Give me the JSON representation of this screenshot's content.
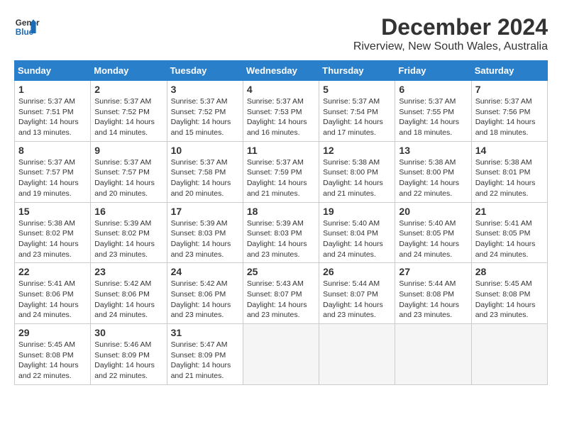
{
  "logo": {
    "general": "General",
    "blue": "Blue"
  },
  "title": "December 2024",
  "location": "Riverview, New South Wales, Australia",
  "weekdays": [
    "Sunday",
    "Monday",
    "Tuesday",
    "Wednesday",
    "Thursday",
    "Friday",
    "Saturday"
  ],
  "weeks": [
    [
      {
        "day": 1,
        "sunrise": "5:37 AM",
        "sunset": "7:51 PM",
        "daylight": "14 hours and 13 minutes."
      },
      {
        "day": 2,
        "sunrise": "5:37 AM",
        "sunset": "7:52 PM",
        "daylight": "14 hours and 14 minutes."
      },
      {
        "day": 3,
        "sunrise": "5:37 AM",
        "sunset": "7:52 PM",
        "daylight": "14 hours and 15 minutes."
      },
      {
        "day": 4,
        "sunrise": "5:37 AM",
        "sunset": "7:53 PM",
        "daylight": "14 hours and 16 minutes."
      },
      {
        "day": 5,
        "sunrise": "5:37 AM",
        "sunset": "7:54 PM",
        "daylight": "14 hours and 17 minutes."
      },
      {
        "day": 6,
        "sunrise": "5:37 AM",
        "sunset": "7:55 PM",
        "daylight": "14 hours and 18 minutes."
      },
      {
        "day": 7,
        "sunrise": "5:37 AM",
        "sunset": "7:56 PM",
        "daylight": "14 hours and 18 minutes."
      }
    ],
    [
      {
        "day": 8,
        "sunrise": "5:37 AM",
        "sunset": "7:57 PM",
        "daylight": "14 hours and 19 minutes."
      },
      {
        "day": 9,
        "sunrise": "5:37 AM",
        "sunset": "7:57 PM",
        "daylight": "14 hours and 20 minutes."
      },
      {
        "day": 10,
        "sunrise": "5:37 AM",
        "sunset": "7:58 PM",
        "daylight": "14 hours and 20 minutes."
      },
      {
        "day": 11,
        "sunrise": "5:37 AM",
        "sunset": "7:59 PM",
        "daylight": "14 hours and 21 minutes."
      },
      {
        "day": 12,
        "sunrise": "5:38 AM",
        "sunset": "8:00 PM",
        "daylight": "14 hours and 21 minutes."
      },
      {
        "day": 13,
        "sunrise": "5:38 AM",
        "sunset": "8:00 PM",
        "daylight": "14 hours and 22 minutes."
      },
      {
        "day": 14,
        "sunrise": "5:38 AM",
        "sunset": "8:01 PM",
        "daylight": "14 hours and 22 minutes."
      }
    ],
    [
      {
        "day": 15,
        "sunrise": "5:38 AM",
        "sunset": "8:02 PM",
        "daylight": "14 hours and 23 minutes."
      },
      {
        "day": 16,
        "sunrise": "5:39 AM",
        "sunset": "8:02 PM",
        "daylight": "14 hours and 23 minutes."
      },
      {
        "day": 17,
        "sunrise": "5:39 AM",
        "sunset": "8:03 PM",
        "daylight": "14 hours and 23 minutes."
      },
      {
        "day": 18,
        "sunrise": "5:39 AM",
        "sunset": "8:03 PM",
        "daylight": "14 hours and 23 minutes."
      },
      {
        "day": 19,
        "sunrise": "5:40 AM",
        "sunset": "8:04 PM",
        "daylight": "14 hours and 24 minutes."
      },
      {
        "day": 20,
        "sunrise": "5:40 AM",
        "sunset": "8:05 PM",
        "daylight": "14 hours and 24 minutes."
      },
      {
        "day": 21,
        "sunrise": "5:41 AM",
        "sunset": "8:05 PM",
        "daylight": "14 hours and 24 minutes."
      }
    ],
    [
      {
        "day": 22,
        "sunrise": "5:41 AM",
        "sunset": "8:06 PM",
        "daylight": "14 hours and 24 minutes."
      },
      {
        "day": 23,
        "sunrise": "5:42 AM",
        "sunset": "8:06 PM",
        "daylight": "14 hours and 24 minutes."
      },
      {
        "day": 24,
        "sunrise": "5:42 AM",
        "sunset": "8:06 PM",
        "daylight": "14 hours and 23 minutes."
      },
      {
        "day": 25,
        "sunrise": "5:43 AM",
        "sunset": "8:07 PM",
        "daylight": "14 hours and 23 minutes."
      },
      {
        "day": 26,
        "sunrise": "5:44 AM",
        "sunset": "8:07 PM",
        "daylight": "14 hours and 23 minutes."
      },
      {
        "day": 27,
        "sunrise": "5:44 AM",
        "sunset": "8:08 PM",
        "daylight": "14 hours and 23 minutes."
      },
      {
        "day": 28,
        "sunrise": "5:45 AM",
        "sunset": "8:08 PM",
        "daylight": "14 hours and 23 minutes."
      }
    ],
    [
      {
        "day": 29,
        "sunrise": "5:45 AM",
        "sunset": "8:08 PM",
        "daylight": "14 hours and 22 minutes."
      },
      {
        "day": 30,
        "sunrise": "5:46 AM",
        "sunset": "8:09 PM",
        "daylight": "14 hours and 22 minutes."
      },
      {
        "day": 31,
        "sunrise": "5:47 AM",
        "sunset": "8:09 PM",
        "daylight": "14 hours and 21 minutes."
      },
      null,
      null,
      null,
      null
    ]
  ],
  "labels": {
    "sunrise": "Sunrise:",
    "sunset": "Sunset:",
    "daylight": "Daylight:"
  }
}
